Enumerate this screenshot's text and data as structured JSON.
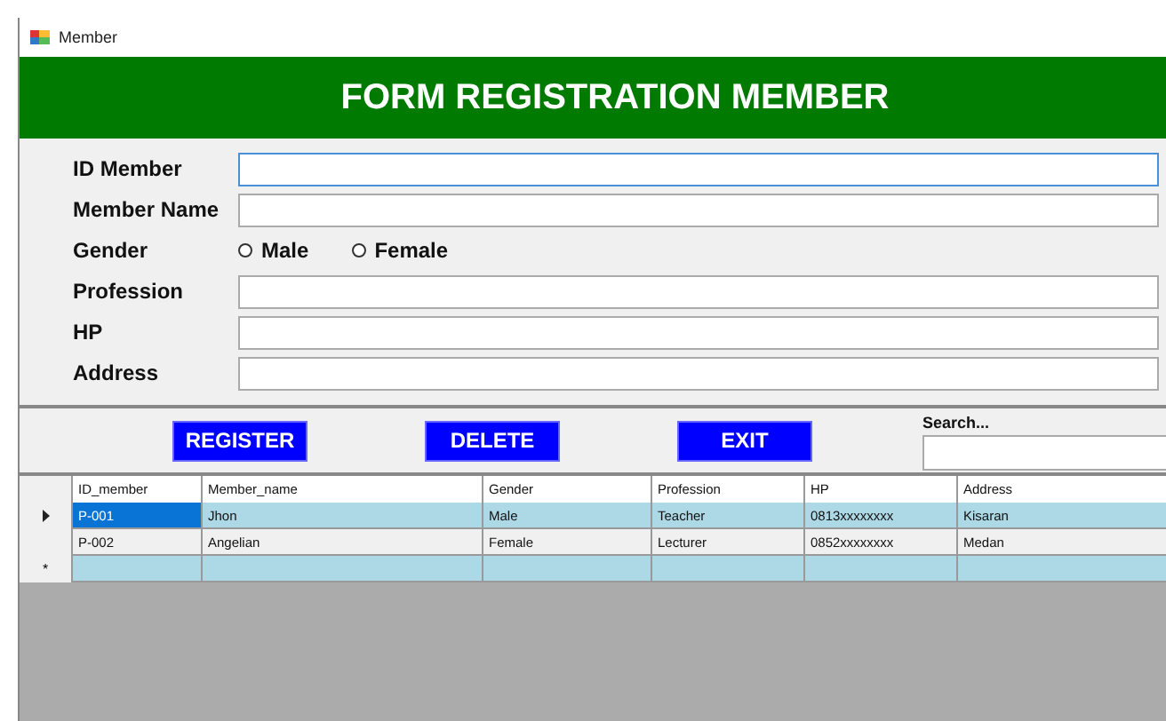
{
  "window": {
    "title": "Member"
  },
  "header": {
    "title": "FORM REGISTRATION MEMBER"
  },
  "form": {
    "fields": [
      {
        "kind": "text",
        "label": "ID Member",
        "focused": true
      },
      {
        "kind": "text",
        "label": "Member Name",
        "focused": false
      },
      {
        "kind": "radio",
        "label": "Gender",
        "options": [
          {
            "label": "Male",
            "checked": false
          },
          {
            "label": "Female",
            "checked": false
          }
        ]
      },
      {
        "kind": "text",
        "label": "Profession",
        "focused": false
      },
      {
        "kind": "text",
        "label": "HP",
        "focused": false
      },
      {
        "kind": "text",
        "label": "Address",
        "focused": false
      }
    ]
  },
  "buttons": [
    "REGISTER",
    "DELETE",
    "EXIT"
  ],
  "search": {
    "label": "Search..."
  },
  "table": {
    "columns": [
      "ID_member",
      "Member_name",
      "Gender",
      "Profession",
      "HP",
      "Address"
    ],
    "rows": [
      {
        "selected": true,
        "cells": [
          "P-001",
          "Jhon",
          "Male",
          "Teacher",
          "0813xxxxxxxx",
          "Kisaran"
        ]
      },
      {
        "selected": false,
        "cells": [
          "P-002",
          "Angelian",
          "Female",
          "Lecturer",
          "0852xxxxxxxx",
          "Medan"
        ]
      }
    ],
    "new_row_marker": "*"
  }
}
